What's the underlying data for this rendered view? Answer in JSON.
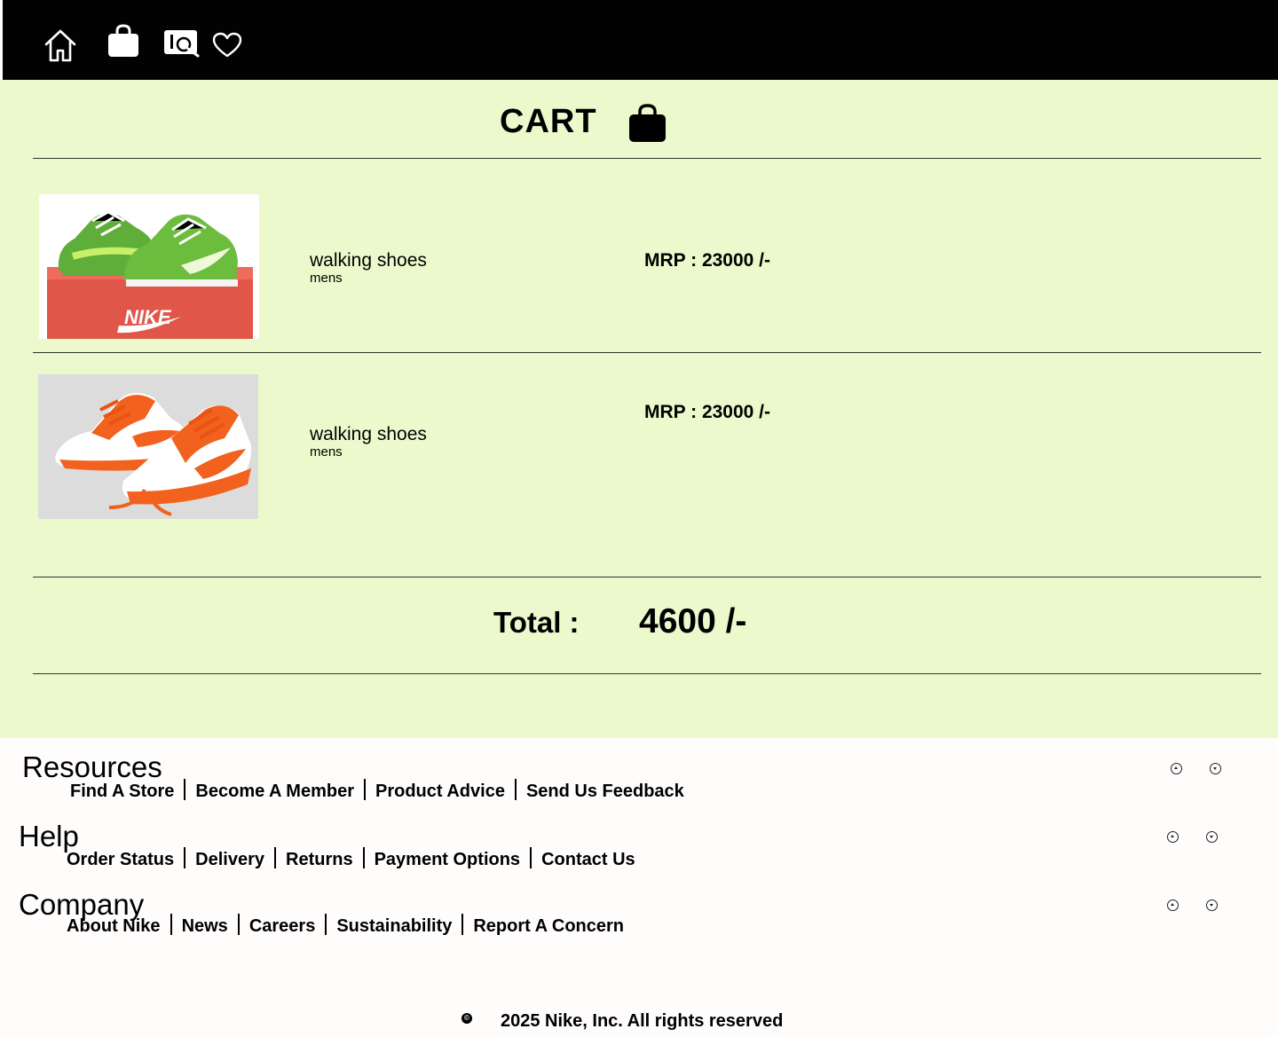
{
  "nav": {
    "icons": [
      "home-icon",
      "shopping-bag-icon",
      "search-catalog-icon",
      "heart-icon"
    ]
  },
  "cart": {
    "title": "CART",
    "items": [
      {
        "name": "walking shoes",
        "category": "mens",
        "price": "MRP : 23000 /-",
        "image": "green Nike sneakers on red shoe box"
      },
      {
        "name": "walking shoes",
        "category": "mens",
        "price": "MRP : 23000 /-",
        "image": "orange and white Nike sneakers"
      }
    ],
    "total_label": "Total :",
    "total_value": "4600 /-"
  },
  "footer": {
    "sections": [
      {
        "heading": "Resources",
        "links": [
          "Find A Store",
          "Become A Member",
          "Product Advice",
          "Send Us Feedback"
        ]
      },
      {
        "heading": "Help",
        "links": [
          "Order Status",
          "Delivery",
          "Returns",
          "Payment Options",
          "Contact Us"
        ]
      },
      {
        "heading": "Company",
        "links": [
          "About Nike",
          "News",
          "Careers",
          "Sustainability",
          "Report A Concern"
        ]
      }
    ],
    "copyright": "2025 Nike, Inc. All rights reserved"
  },
  "colors": {
    "topbar": "#020202",
    "main_bg": "#ebf9cc",
    "footer_bg": "#fffcfc"
  }
}
